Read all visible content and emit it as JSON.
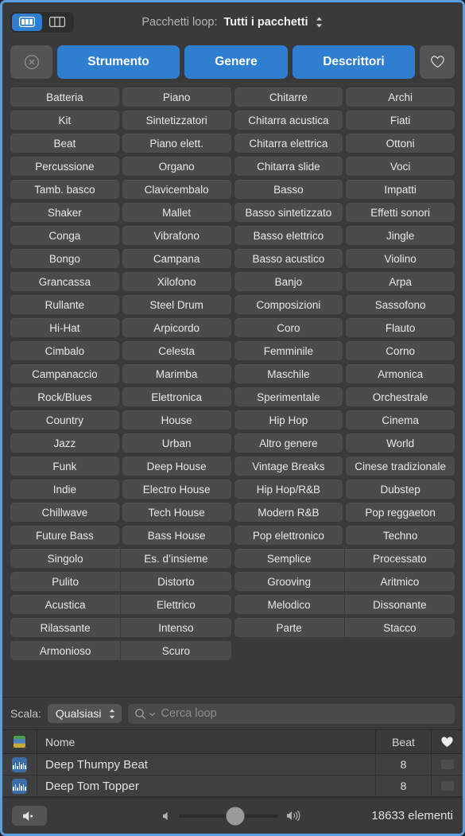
{
  "window": {
    "accent_color": "#2f7fd1",
    "background": "#3a3a3a",
    "border_color": "#5a9fe0"
  },
  "toolbar": {
    "view_grid_icon": "grid-view-icon",
    "view_column_icon": "column-view-icon",
    "packs_label": "Pacchetti loop:",
    "packs_value": "Tutti i pacchetti",
    "packs_chevron_icon": "chevron-up-down-icon"
  },
  "filters": {
    "reset_icon": "circle-x-icon",
    "buttons": [
      {
        "label": "Strumento",
        "active": true
      },
      {
        "label": "Genere",
        "active": true
      },
      {
        "label": "Descrittori",
        "active": true
      }
    ],
    "favorites_icon": "heart-outline-icon"
  },
  "keyword_grid": {
    "rows": [
      [
        "Batteria",
        "Piano",
        "Chitarre",
        "Archi"
      ],
      [
        "Kit",
        "Sintetizzatori",
        "Chitarra acustica",
        "Fiati"
      ],
      [
        "Beat",
        "Piano elett.",
        "Chitarra elettrica",
        "Ottoni"
      ],
      [
        "Percussione",
        "Organo",
        "Chitarra slide",
        "Voci"
      ],
      [
        "Tamb. basco",
        "Clavicembalo",
        "Basso",
        "Impatti"
      ],
      [
        "Shaker",
        "Mallet",
        "Basso sintetizzato",
        "Effetti sonori"
      ],
      [
        "Conga",
        "Vibrafono",
        "Basso elettrico",
        "Jingle"
      ],
      [
        "Bongo",
        "Campana",
        "Basso acustico",
        "Violino"
      ],
      [
        "Grancassa",
        "Xilofono",
        "Banjo",
        "Arpa"
      ],
      [
        "Rullante",
        "Steel Drum",
        "Composizioni",
        "Sassofono"
      ],
      [
        "Hi-Hat",
        "Arpicordo",
        "Coro",
        "Flauto"
      ],
      [
        "Cimbalo",
        "Celesta",
        "Femminile",
        "Corno"
      ],
      [
        "Campanaccio",
        "Marimba",
        "Maschile",
        "Armonica"
      ],
      [
        "Rock/Blues",
        "Elettronica",
        "Sperimentale",
        "Orchestrale"
      ],
      [
        "Country",
        "House",
        "Hip Hop",
        "Cinema"
      ],
      [
        "Jazz",
        "Urban",
        "Altro genere",
        "World"
      ],
      [
        "Funk",
        "Deep House",
        "Vintage Breaks",
        "Cinese tradizionale"
      ],
      [
        "Indie",
        "Electro House",
        "Hip Hop/R&B",
        "Dubstep"
      ],
      [
        "Chillwave",
        "Tech House",
        "Modern R&B",
        "Pop reggaeton"
      ],
      [
        "Future Bass",
        "Bass House",
        "Pop elettronico",
        "Techno"
      ]
    ],
    "descriptor_rows": [
      [
        "Singolo",
        "Es. d’insieme",
        "Semplice",
        "Processato"
      ],
      [
        "Pulito",
        "Distorto",
        "Grooving",
        "Aritmico"
      ],
      [
        "Acustica",
        "Elettrico",
        "Melodico",
        "Dissonante"
      ],
      [
        "Rilassante",
        "Intenso",
        "Parte",
        "Stacco"
      ],
      [
        "Armonioso",
        "Scuro",
        "",
        ""
      ]
    ]
  },
  "searchbar": {
    "scale_label": "Scala:",
    "scale_value": "Qualsiasi",
    "scale_chevron_icon": "chevron-up-down-icon",
    "search_icon": "search-icon",
    "search_dropdown_icon": "chevron-down-icon",
    "search_value": "",
    "search_placeholder": "Cerca loop"
  },
  "results": {
    "header": {
      "type_icon": "loop-type-icon",
      "name": "Nome",
      "beat": "Beat",
      "favorite_icon": "heart-filled-icon"
    },
    "rows": [
      {
        "icon": "audio-loop-icon",
        "name": "Deep Thumpy Beat",
        "beat": "8",
        "favorite": false
      },
      {
        "icon": "audio-loop-icon",
        "name": "Deep Tom Topper",
        "beat": "8",
        "favorite": false
      }
    ]
  },
  "statusbar": {
    "mute_icon": "speaker-mute-icon",
    "volume_low_icon": "speaker-low-icon",
    "volume_high_icon": "speaker-high-icon",
    "volume_percent": 57,
    "count_text": "18633 elementi"
  }
}
